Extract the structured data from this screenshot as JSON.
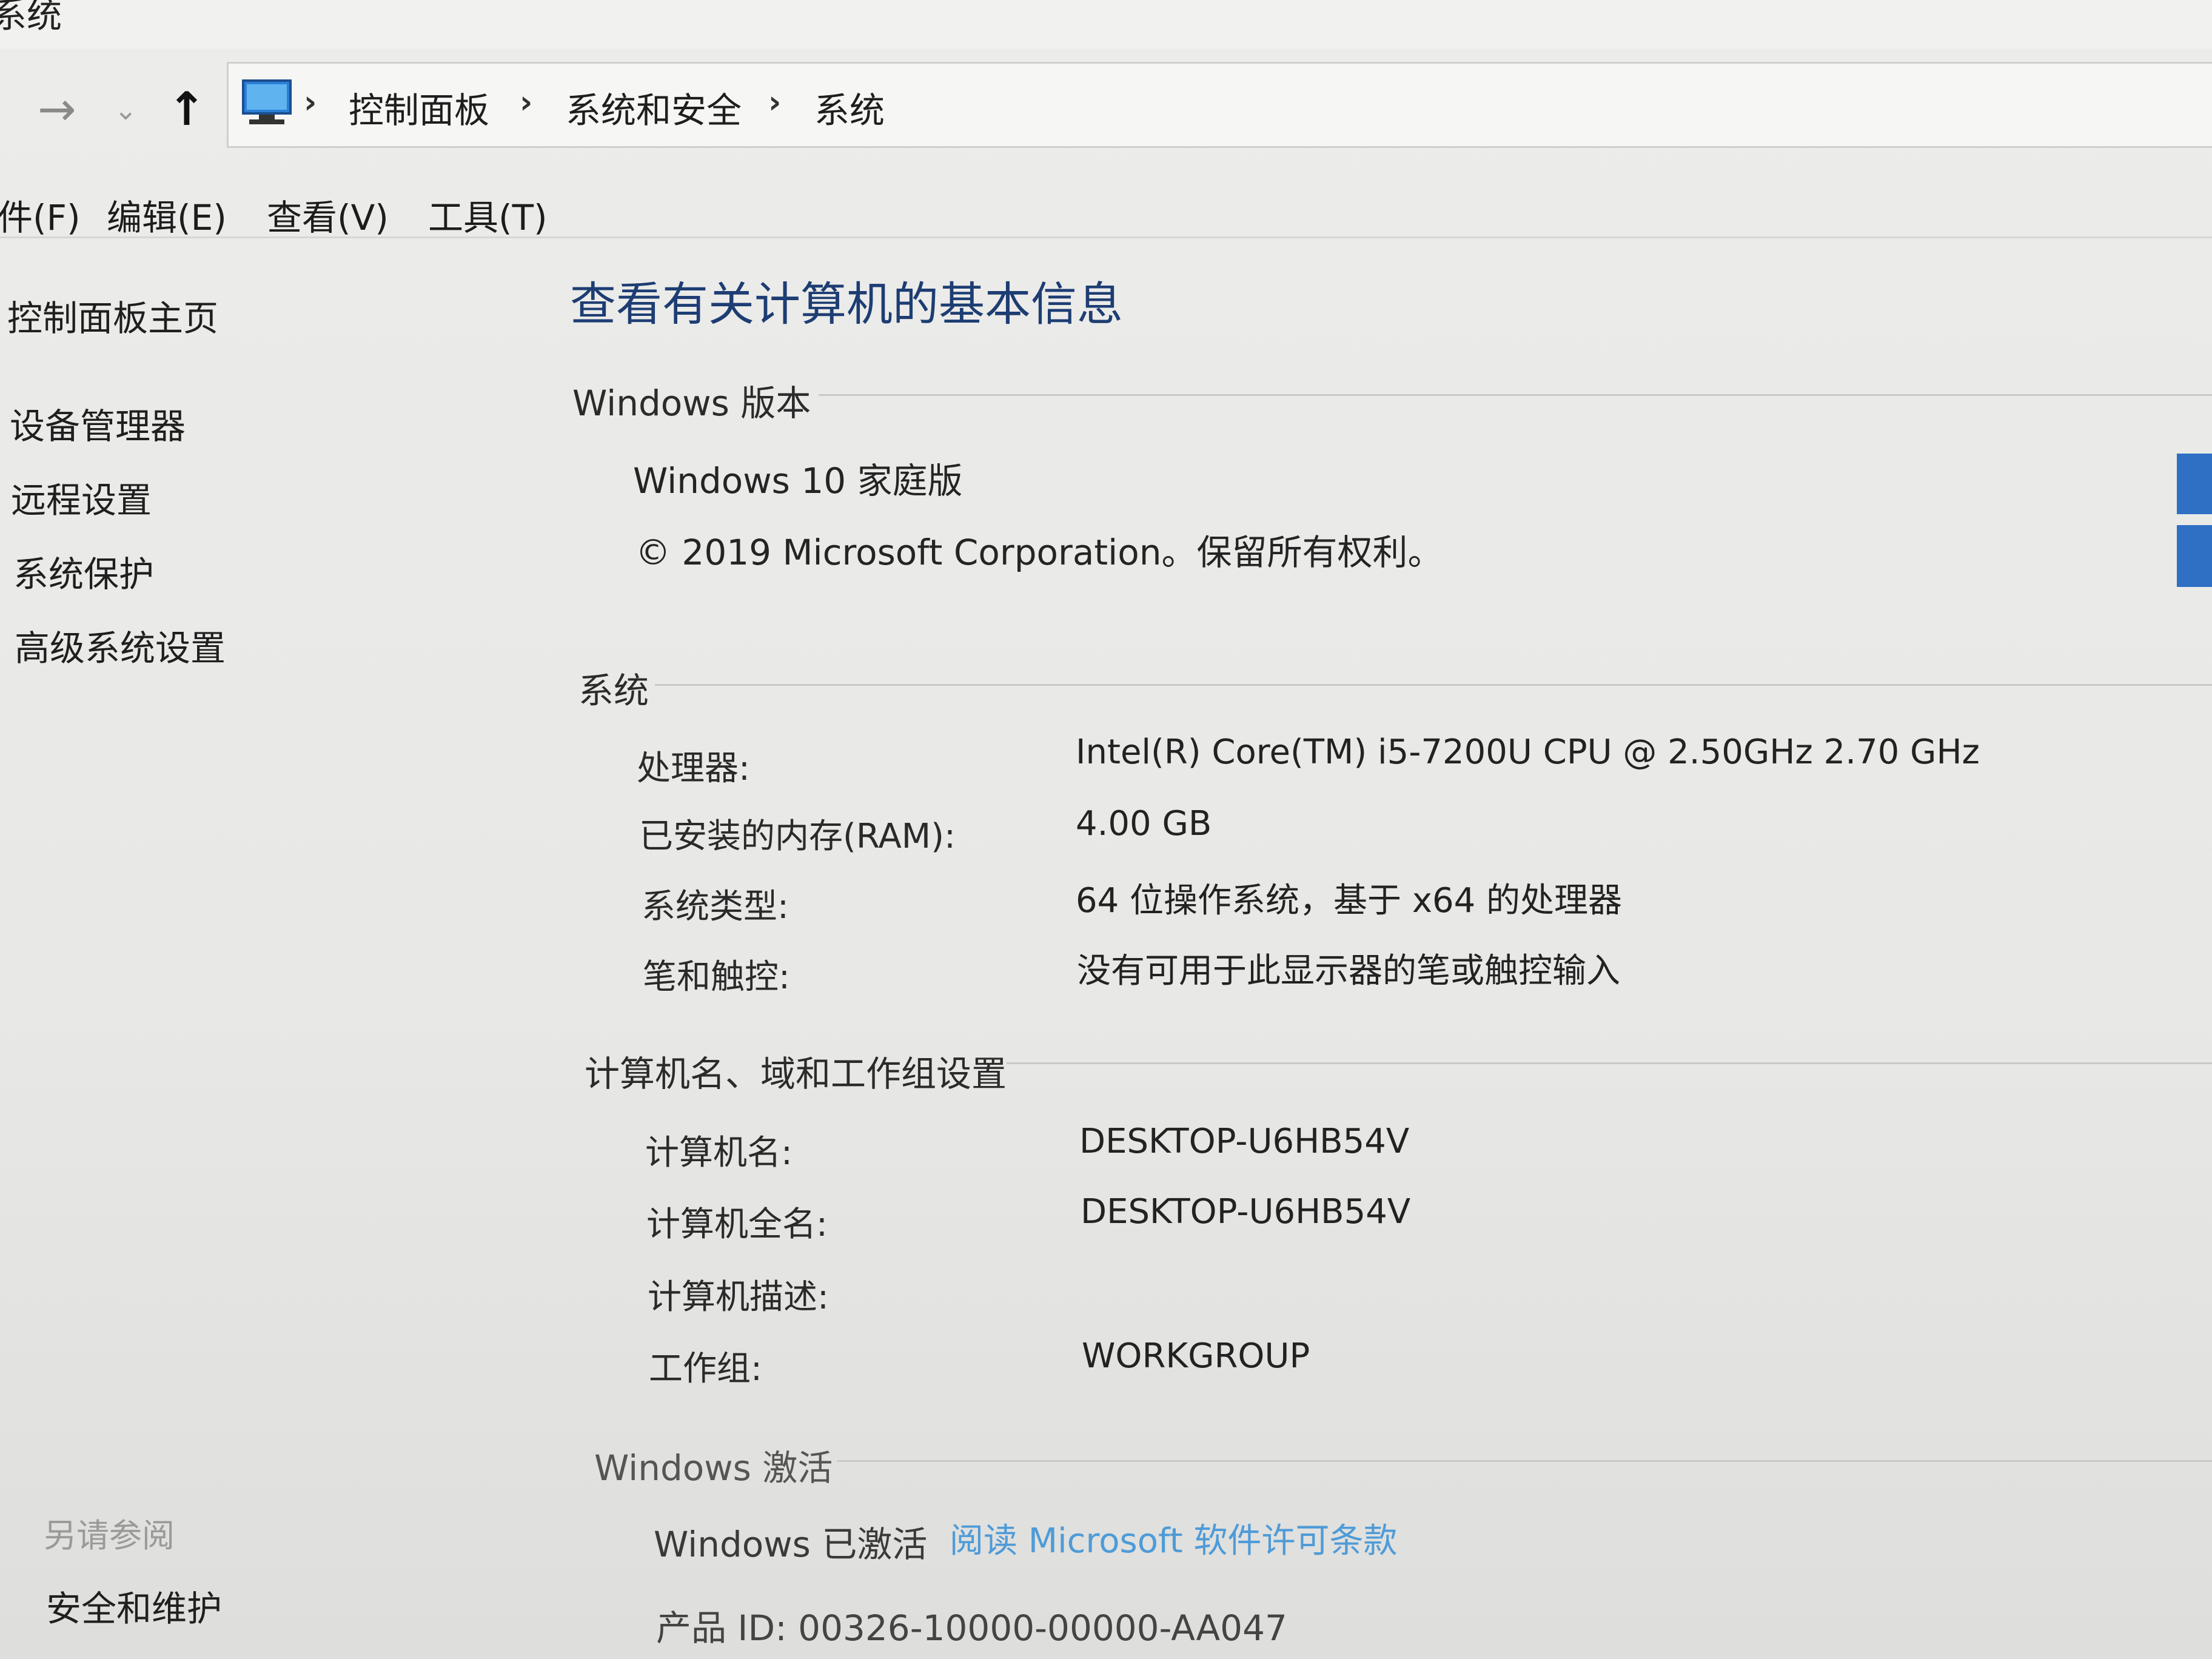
{
  "window": {
    "title": "系统"
  },
  "navigation": {
    "forward_icon": "→",
    "dropdown_icon": "⌄",
    "up_icon": "↑",
    "breadcrumbs": [
      "控制面板",
      "系统和安全",
      "系统"
    ],
    "separator": "›"
  },
  "menu": {
    "items": [
      "件(F)",
      "编辑(E)",
      "查看(V)",
      "工具(T)"
    ]
  },
  "sidebar": {
    "home": "控制面板主页",
    "items": [
      "设备管理器",
      "远程设置",
      "系统保护",
      "高级系统设置"
    ],
    "see_also_title": "另请参阅",
    "see_also_items": [
      "安全和维护"
    ]
  },
  "main": {
    "heading": "查看有关计算机的基本信息",
    "windows_edition": {
      "title": "Windows 版本",
      "edition": "Windows 10 家庭版",
      "copyright": "© 2019 Microsoft Corporation。保留所有权利。"
    },
    "system": {
      "title": "系统",
      "rows": [
        {
          "label": "处理器:",
          "value": "Intel(R) Core(TM) i5-7200U CPU @ 2.50GHz   2.70 GHz"
        },
        {
          "label": "已安装的内存(RAM):",
          "value": "4.00 GB"
        },
        {
          "label": "系统类型:",
          "value": "64 位操作系统，基于 x64 的处理器"
        },
        {
          "label": "笔和触控:",
          "value": "没有可用于此显示器的笔或触控输入"
        }
      ]
    },
    "computer_name": {
      "title": "计算机名、域和工作组设置",
      "rows": [
        {
          "label": "计算机名:",
          "value": "DESKTOP-U6HB54V"
        },
        {
          "label": "计算机全名:",
          "value": "DESKTOP-U6HB54V"
        },
        {
          "label": "计算机描述:",
          "value": ""
        },
        {
          "label": "工作组:",
          "value": "WORKGROUP"
        }
      ]
    },
    "activation": {
      "title": "Windows 激活",
      "status": "Windows 已激活",
      "license_link": "阅读 Microsoft 软件许可条款",
      "product_id": "产品 ID: 00326-10000-00000-AA047"
    }
  },
  "colors": {
    "heading": "#1d3d73",
    "link": "#4e9bd8",
    "windows_logo": "#2f6fc4"
  }
}
